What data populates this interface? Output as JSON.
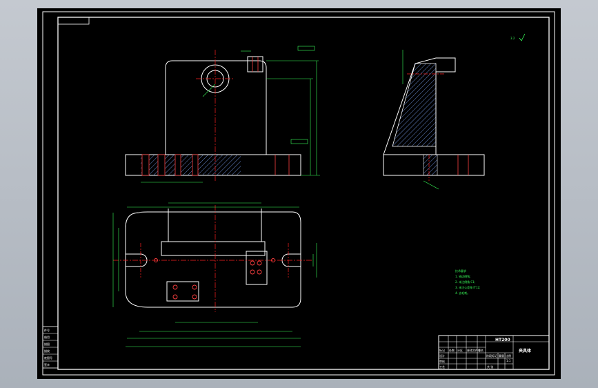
{
  "colors": {
    "background": "#000000",
    "frame": "#ffffff",
    "outline": "#ffffff",
    "dimension": "#39ff5a",
    "centerline": "#ff2020",
    "hatch": "#7fa8ff",
    "holes": "#ff4040",
    "viewport_bg": "#b4bac2"
  },
  "roughness_mark": "3.2",
  "notes": {
    "heading": "技术要求",
    "lines": [
      "1. 锐边倒钝;",
      "2. 未注倒角 C1;",
      "3. 未注公差按 IT12;",
      "4. 去毛刺。"
    ]
  },
  "title_block": {
    "material": "HT200",
    "part_name": "夹具体",
    "scale": "1:1",
    "labels": [
      "标记",
      "处数",
      "分区",
      "更改文件号",
      "签名",
      "年月日",
      "设计",
      "审核",
      "工艺",
      "标准化",
      "批准",
      "阶段标记",
      "重量",
      "比例",
      "共 张",
      "第 张"
    ]
  },
  "side_table": {
    "rows": [
      "件号",
      "借用",
      "描图",
      "描校",
      "底图号",
      "签字"
    ]
  }
}
